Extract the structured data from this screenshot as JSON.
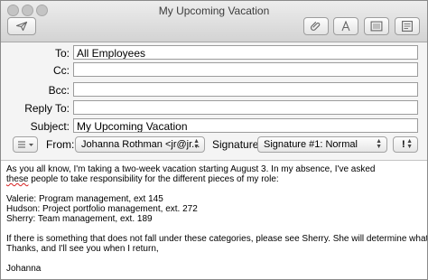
{
  "window": {
    "title": "My Upcoming Vacation"
  },
  "toolbar": {
    "send": "send-icon",
    "attach": "paperclip-icon",
    "fonts": "fonts-icon",
    "photo": "photo-browser-icon",
    "stationery": "stationery-icon"
  },
  "fields": {
    "to_label": "To:",
    "to_value": "All Employees",
    "cc_label": "Cc:",
    "cc_value": "",
    "bcc_label": "Bcc:",
    "bcc_value": "",
    "reply_label": "Reply To:",
    "reply_value": "",
    "subject_label": "Subject:",
    "subject_value": "My Upcoming Vacation"
  },
  "options": {
    "from_label": "From:",
    "from_value": "Johanna Rothman <jr@jr...",
    "signature_label": "Signature:",
    "signature_value": "Signature #1: Normal",
    "priority_value": "!"
  },
  "message": {
    "line1": "As you all know, I'm taking a two-week vacation starting August 3. In my absence, I've asked",
    "line2_word": "these",
    "line2_rest": " people to take responsibility for the different pieces of my role:",
    "items": [
      "Valerie: Program management, ext 145",
      "Hudson: Project portfolio management, ext. 272",
      "Sherry: Team management, ext. 189"
    ],
    "closing1": "If there is something that does not fall under these categories, please see Sherry. She will determine what to do.",
    "closing2": "Thanks, and I'll see you when I return,",
    "signoff": "Johanna"
  }
}
